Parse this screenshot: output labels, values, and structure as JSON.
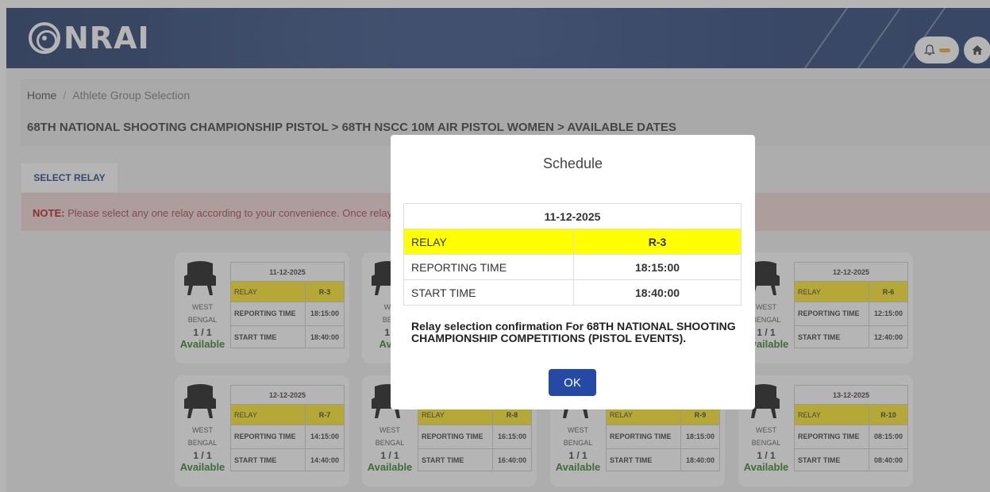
{
  "header": {
    "logo_text": "NRAI",
    "bell_icon": "bell-icon",
    "home_icon": "home-icon",
    "accent": "#f5a623"
  },
  "breadcrumb": {
    "home": "Home",
    "separator": "/",
    "current": "Athlete Group Selection"
  },
  "page_title": "68TH NATIONAL SHOOTING CHAMPIONSHIP PISTOL > 68TH NSCC 10M AIR PISTOL WOMEN > AVAILABLE DATES",
  "tab_label": "SELECT RELAY",
  "note": {
    "label": "NOTE:",
    "text": "Please select any one relay according to your convenience. Once relay h"
  },
  "cards": [
    {
      "date": "11-12-2025",
      "relay_label": "RELAY",
      "relay": "R-3",
      "reporting_label": "REPORTING TIME",
      "reporting": "18:15:00",
      "start_label": "START TIME",
      "start": "18:40:00",
      "state_line1": "WEST",
      "state_line2": "BENGAL",
      "count": "1 / 1",
      "status": "Available"
    },
    {
      "date": "12-12-2025",
      "relay_label": "RELAY",
      "relay": "R-6",
      "reporting_label": "REPORTING TIME",
      "reporting": "12:15:00",
      "start_label": "START TIME",
      "start": "12:40:00",
      "state_line1": "WEST",
      "state_line2": "BENGAL",
      "count": "1 / 1",
      "status": "Available"
    },
    {
      "date": "12-12-2025",
      "relay_label": "RELAY",
      "relay": "R-7",
      "reporting_label": "REPORTING TIME",
      "reporting": "14:15:00",
      "start_label": "START TIME",
      "start": "14:40:00",
      "state_line1": "WEST",
      "state_line2": "BENGAL",
      "count": "1 / 1",
      "status": "Available"
    },
    {
      "date": "",
      "relay_label": "RELAY",
      "relay": "R-8",
      "reporting_label": "REPORTING TIME",
      "reporting": "16:15:00",
      "start_label": "START TIME",
      "start": "16:40:00",
      "state_line1": "WEST",
      "state_line2": "BENGAL",
      "count": "1 / 1",
      "status": "Available"
    },
    {
      "date": "",
      "relay_label": "RELAY",
      "relay": "R-9",
      "reporting_label": "REPORTING TIME",
      "reporting": "18:15:00",
      "start_label": "START TIME",
      "start": "18:40:00",
      "state_line1": "WEST",
      "state_line2": "BENGAL",
      "count": "1 / 1",
      "status": "Available"
    },
    {
      "date": "13-12-2025",
      "relay_label": "RELAY",
      "relay": "R-10",
      "reporting_label": "REPORTING TIME",
      "reporting": "08:15:00",
      "start_label": "START TIME",
      "start": "08:40:00",
      "state_line1": "WEST",
      "state_line2": "BENGAL",
      "count": "1 / 1",
      "status": "Available"
    }
  ],
  "partial_cards": [
    {
      "state_line1": "WE",
      "state_line2": "BEN",
      "count": "1 /",
      "status": "Avai"
    }
  ],
  "modal": {
    "title": "Schedule",
    "date": "11-12-2025",
    "relay_label": "RELAY",
    "relay": "R-3",
    "reporting_label": "REPORTING TIME",
    "reporting": "18:15:00",
    "start_label": "START TIME",
    "start": "18:40:00",
    "confirm_text": "Relay selection confirmation For 68TH NATIONAL SHOOTING CHAMPIONSHIP COMPETITIONS (PISTOL EVENTS).",
    "ok_label": "OK"
  }
}
